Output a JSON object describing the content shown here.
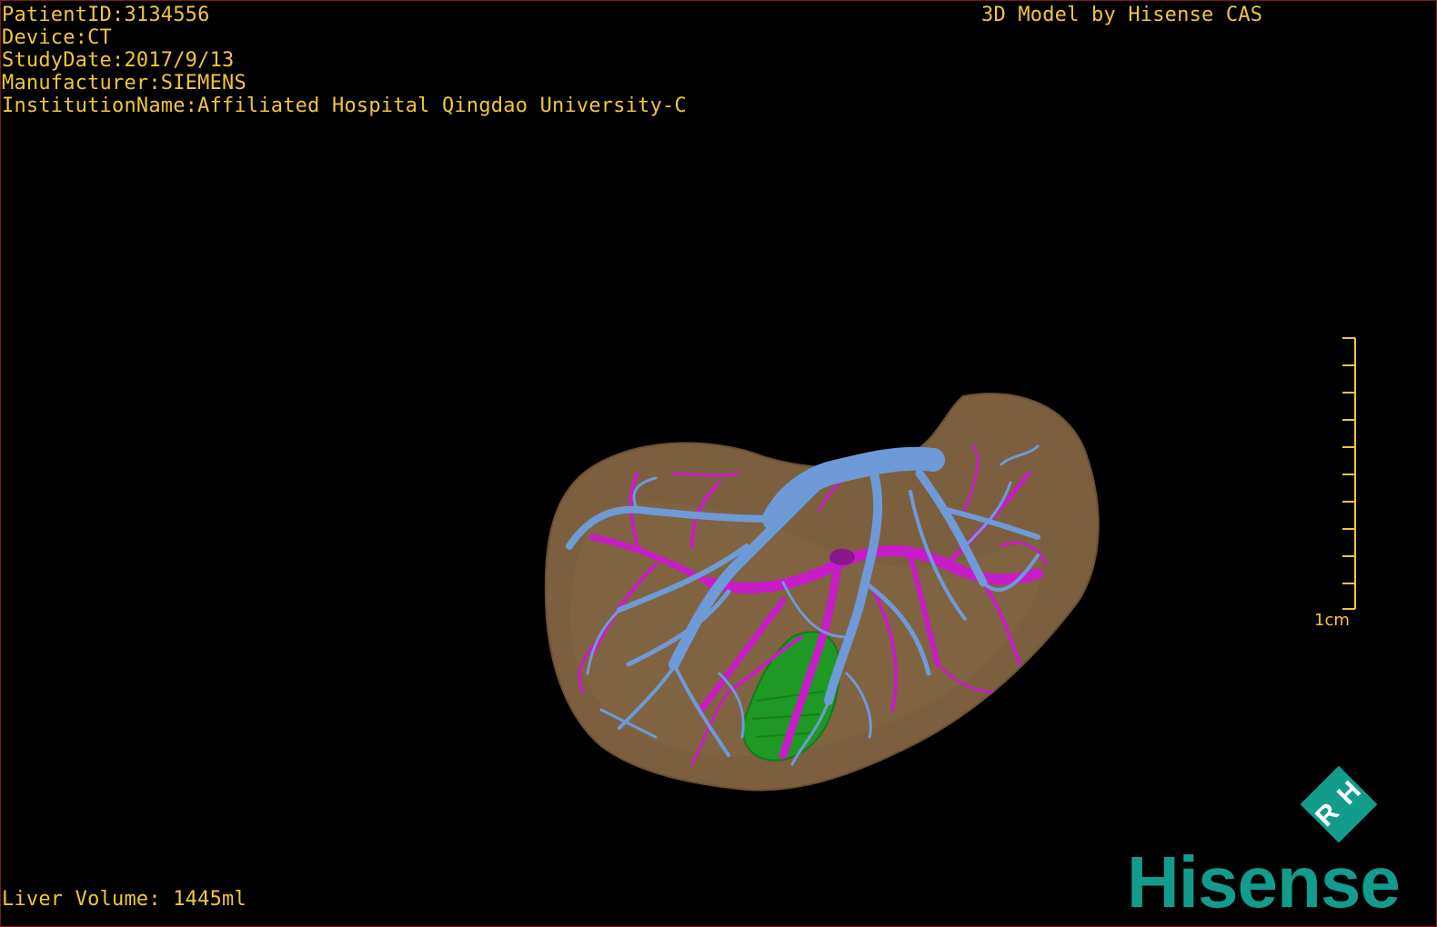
{
  "viewer": {
    "patient_id_line": "PatientID:3134556",
    "device_line": "Device:CT",
    "study_date_line": "StudyDate:2017/9/13",
    "manufacturer_line": "Manufacturer:SIEMENS",
    "institution_line": "InstitutionName:Affiliated Hospital Qingdao University-C",
    "brand_caption": "3D Model by Hisense CAS",
    "liver_volume_line": "Liver Volume: 1445ml"
  },
  "scale_bar": {
    "label": "1cm"
  },
  "logo": {
    "wordmark": "Hisense",
    "badge_letters": [
      "H",
      "R"
    ],
    "brand_color": "#129c8c"
  },
  "model": {
    "structures": [
      "liver-surface-icon",
      "portal-vein-icon",
      "hepatic-vein-icon",
      "gallbladder-icon"
    ],
    "colors": {
      "liver": "#7b5f3e",
      "hepatic_vein": "#6f9ad8",
      "portal_vein": "#c81cc8",
      "gallbladder": "#1e9a24",
      "overlay_text": "#f2c53d"
    }
  }
}
